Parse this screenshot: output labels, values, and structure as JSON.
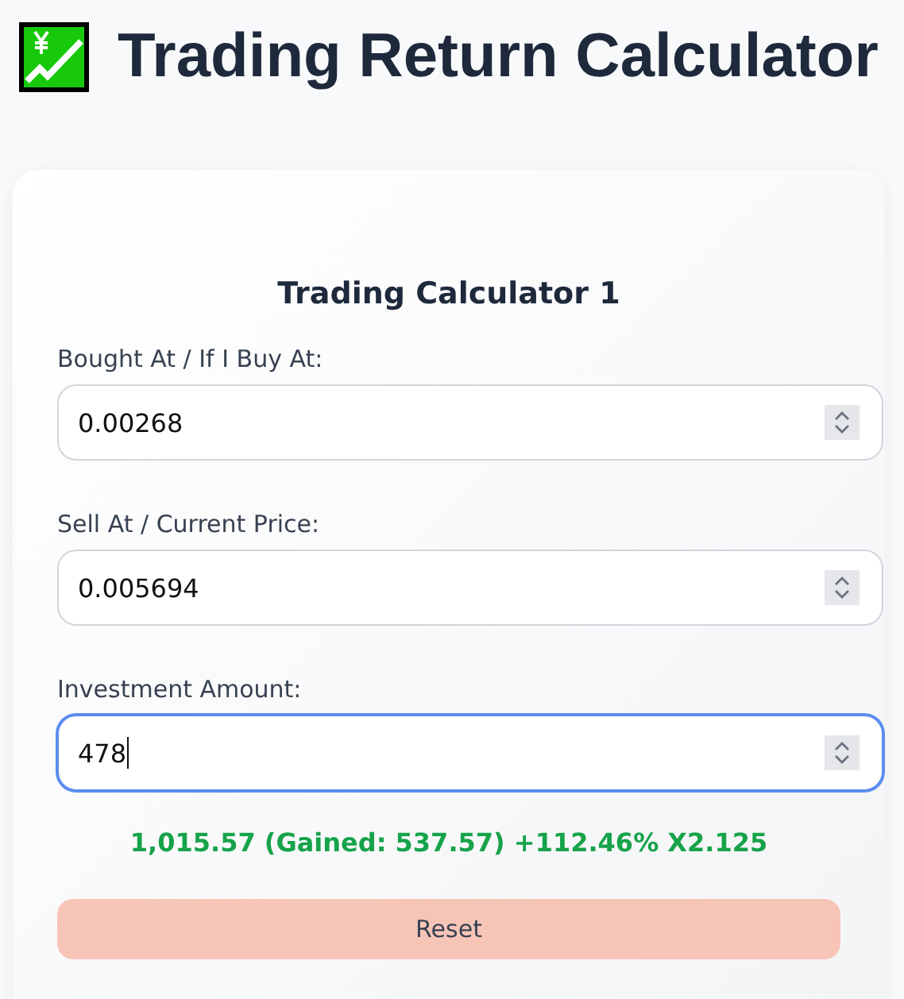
{
  "page": {
    "title": "Trading Return Calculator"
  },
  "calculator": {
    "title": "Trading Calculator 1",
    "fields": [
      {
        "label": "Bought At / If I Buy At:",
        "value": "0.00268",
        "focused": false
      },
      {
        "label": "Sell At / Current Price:",
        "value": "0.005694",
        "focused": false
      },
      {
        "label": "Investment Amount:",
        "value": "478",
        "focused": true
      }
    ],
    "result": "1,015.57 (Gained: 537.57) +112.46% X2.125",
    "reset_button": "Reset"
  }
}
